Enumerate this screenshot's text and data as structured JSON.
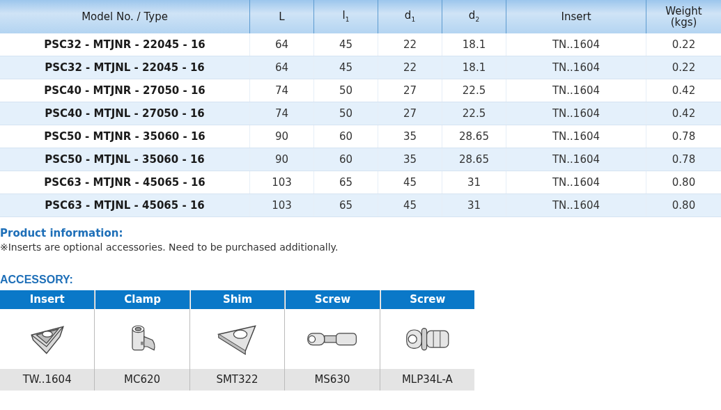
{
  "table": {
    "columns": [
      "Model No. / Type",
      "L",
      "l$_{1}$",
      "d$_{1}$",
      "d$_{2}$",
      "Insert",
      "Weight\n(kgs)"
    ],
    "rows": [
      [
        "PSC32 - MTJNR - 22045 - 16",
        "64",
        "45",
        "22",
        "18.1",
        "TN..1604",
        "0.22"
      ],
      [
        "PSC32 - MTJNL - 22045 - 16",
        "64",
        "45",
        "22",
        "18.1",
        "TN..1604",
        "0.22"
      ],
      [
        "PSC40 - MTJNR - 27050 - 16",
        "74",
        "50",
        "27",
        "22.5",
        "TN..1604",
        "0.42"
      ],
      [
        "PSC40 - MTJNL - 27050 - 16",
        "74",
        "50",
        "27",
        "22.5",
        "TN..1604",
        "0.42"
      ],
      [
        "PSC50 - MTJNR - 35060 - 16",
        "90",
        "60",
        "35",
        "28.65",
        "TN..1604",
        "0.78"
      ],
      [
        "PSC50 - MTJNL - 35060 - 16",
        "90",
        "60",
        "35",
        "28.65",
        "TN..1604",
        "0.78"
      ],
      [
        "PSC63 - MTJNR - 45065 - 16",
        "103",
        "65",
        "45",
        "31",
        "TN..1604",
        "0.80"
      ],
      [
        "PSC63 - MTJNL - 45065 - 16",
        "103",
        "65",
        "45",
        "31",
        "TN..1604",
        "0.80"
      ]
    ]
  },
  "product_info": {
    "heading": "Product information:",
    "note": "※Inserts are optional accessories. Need to be purchased additionally."
  },
  "accessory": {
    "heading": "ACCESSORY:",
    "items": [
      {
        "category": "Insert",
        "kind": "insert",
        "code": "TW..1604"
      },
      {
        "category": "Clamp",
        "kind": "clamp",
        "code": "MC620"
      },
      {
        "category": "Shim",
        "kind": "shim",
        "code": "SMT322"
      },
      {
        "category": "Screw",
        "kind": "screw",
        "code": "MS630"
      },
      {
        "category": "Screw",
        "kind": "collar-screw",
        "code": "MLP34L-A"
      }
    ]
  }
}
